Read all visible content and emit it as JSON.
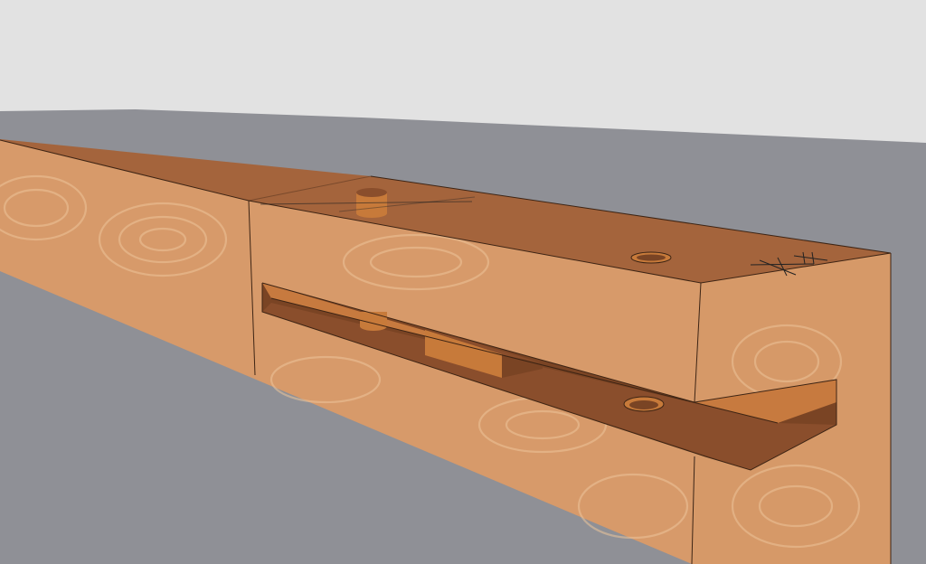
{
  "scene": {
    "subject": "wooden-beam-with-slot-and-dowels",
    "colors": {
      "sky": "#e2e2e2",
      "ground": "#8f9096",
      "wood_top": "#a4643c",
      "wood_side": "#d79a6a",
      "wood_end": "#d69968",
      "slot_interior": "#7a4424",
      "slot_floor": "#8a4e2c",
      "slot_back": "#c77a3f",
      "dowel": "#c77a3a",
      "grain": "#edc49a",
      "edge_line": "#3d2414"
    }
  }
}
